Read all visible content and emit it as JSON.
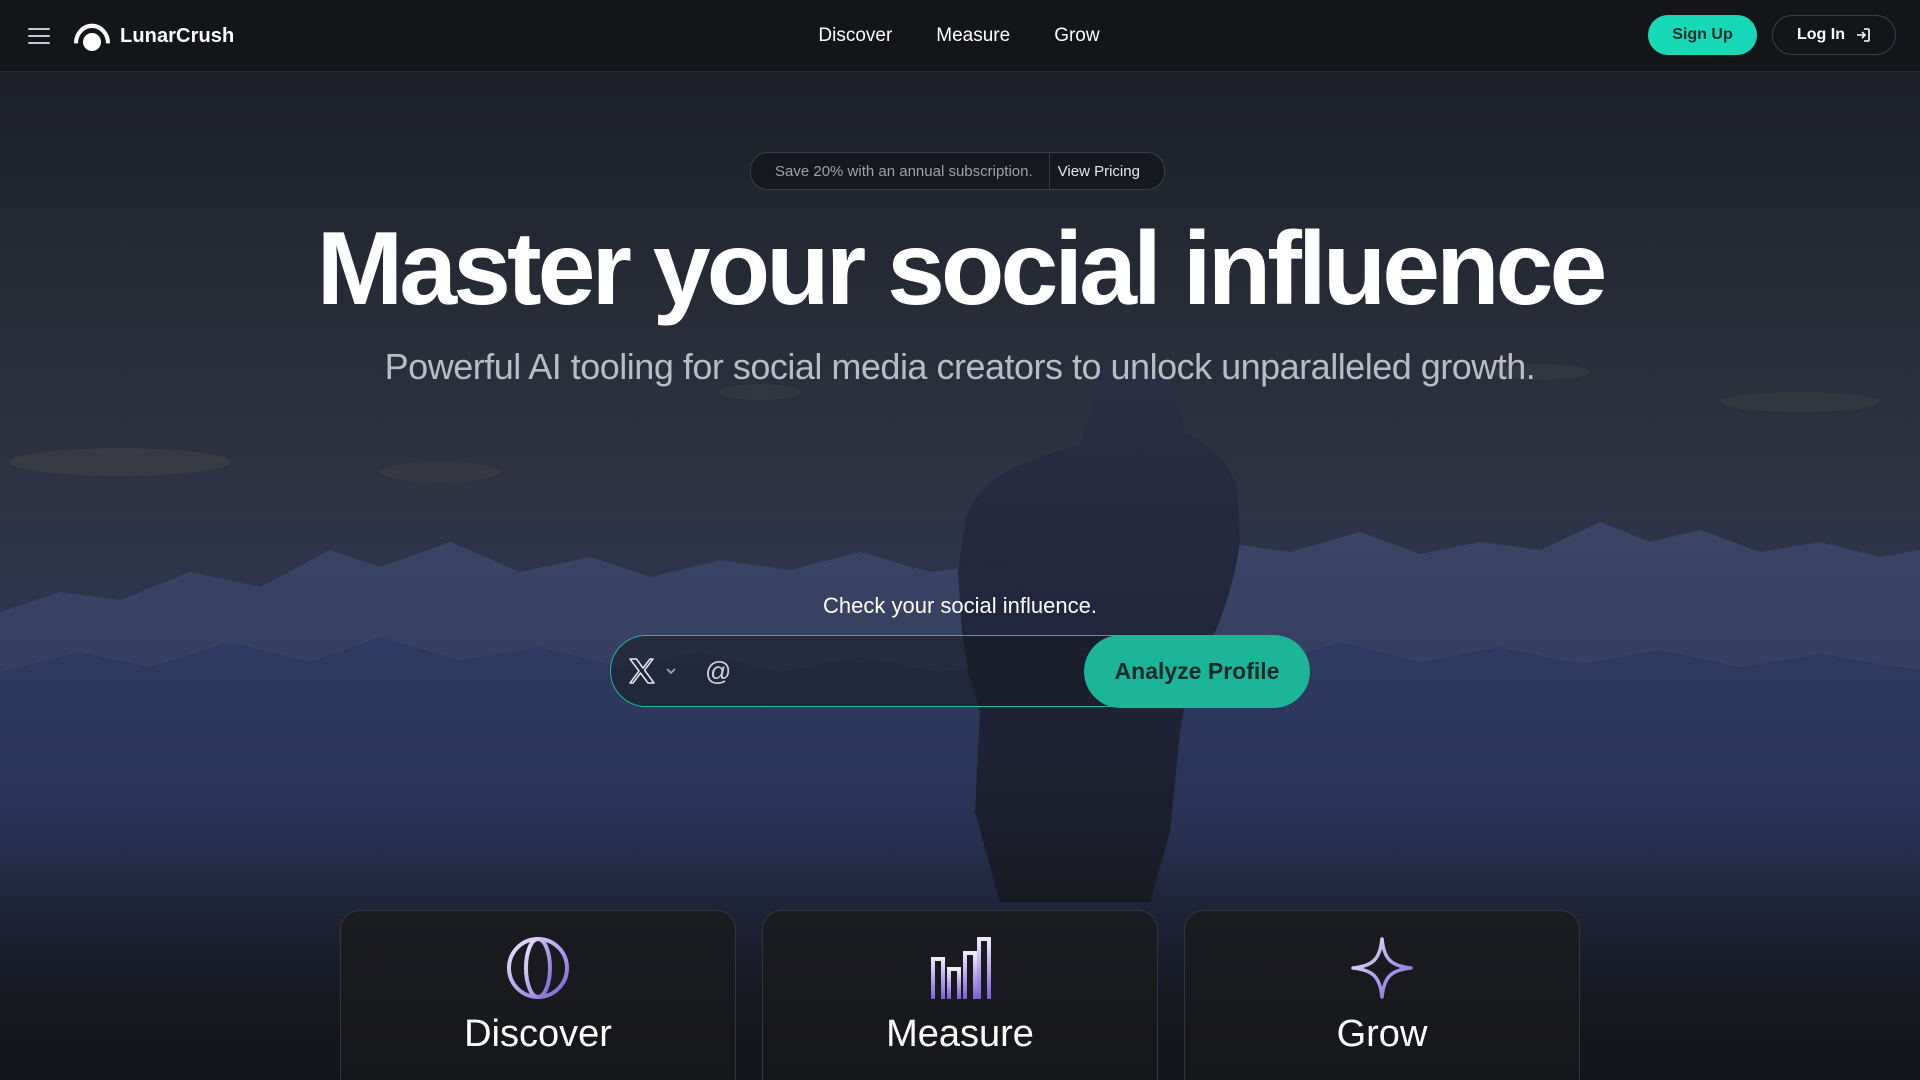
{
  "header": {
    "brand": "LunarCrush",
    "nav": [
      "Discover",
      "Measure",
      "Grow"
    ],
    "signup_label": "Sign Up",
    "login_label": "Log In"
  },
  "promo": {
    "text": "Save 20% with an annual subscription.",
    "link": "View Pricing"
  },
  "hero": {
    "title": "Master your social influence",
    "subtitle": "Powerful AI tooling for social media creators to unlock unparalleled growth.",
    "check_label": "Check your social influence.",
    "at_symbol": "@",
    "handle_placeholder": "",
    "analyze_label": "Analyze Profile"
  },
  "features": [
    {
      "title": "Discover",
      "icon": "globe-icon"
    },
    {
      "title": "Measure",
      "icon": "bar-chart-icon"
    },
    {
      "title": "Grow",
      "icon": "sparkle-icon"
    }
  ],
  "colors": {
    "accent": "#17d9b7",
    "accent_dark": "#1cb597",
    "icon_gradient_start": "#e8e4ff",
    "icon_gradient_end": "#7b5fd6",
    "background": "#141519"
  }
}
